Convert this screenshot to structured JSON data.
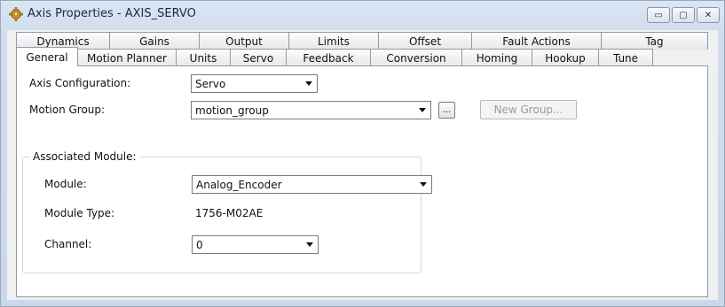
{
  "window": {
    "title": "Axis Properties - AXIS_SERVO",
    "controls": {
      "minimize_glyph": "▭",
      "maximize_glyph": "▢",
      "close_glyph": "✕"
    }
  },
  "tabs_back": [
    "Dynamics",
    "Gains",
    "Output",
    "Limits",
    "Offset",
    "Fault Actions",
    "Tag"
  ],
  "tabs_front": [
    "General",
    "Motion Planner",
    "Units",
    "Servo",
    "Feedback",
    "Conversion",
    "Homing",
    "Hookup",
    "Tune"
  ],
  "active_tab": "General",
  "general": {
    "axis_configuration_label": "Axis Configuration:",
    "axis_configuration_value": "Servo",
    "motion_group_label": "Motion Group:",
    "motion_group_value": "motion_group",
    "browse_label": "...",
    "new_group_label": "New Group...",
    "associated_module": {
      "legend": "Associated Module:",
      "module_label": "Module:",
      "module_value": "Analog_Encoder",
      "module_type_label": "Module Type:",
      "module_type_value": "1756-M02AE",
      "channel_label": "Channel:",
      "channel_value": "0"
    }
  },
  "colors": {
    "title_gradient_top": "#dbe6f4",
    "title_gradient_bottom": "#c9d8ea",
    "border": "#8e9aab",
    "disabled_text": "#9c9c9c"
  },
  "icons": {
    "app": "gear-icon",
    "dropdown": "chevron-down-icon"
  }
}
